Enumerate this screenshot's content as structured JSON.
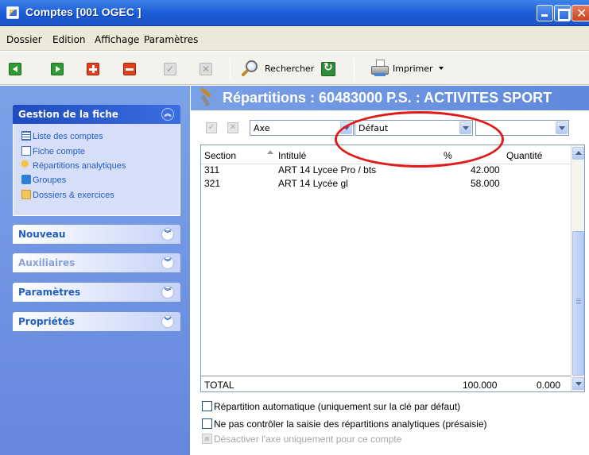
{
  "window": {
    "title": "Comptes [001 OGEC ]"
  },
  "menu": {
    "items": [
      "Dossier",
      "Edition",
      "Affichage",
      "Paramètres"
    ]
  },
  "toolbar": {
    "search_label": "Rechercher",
    "print_label": "Imprimer"
  },
  "sidebar": {
    "panels": [
      {
        "label": "Gestion de la fiche",
        "expanded": true,
        "items": [
          {
            "label": "Liste des comptes",
            "icon": "list-icon"
          },
          {
            "label": "Fiche compte",
            "icon": "card-icon"
          },
          {
            "label": "Répartitions analytiques",
            "icon": "key-icon"
          },
          {
            "label": "Groupes",
            "icon": "group-icon"
          },
          {
            "label": "Dossiers & exercices",
            "icon": "folder-icon"
          }
        ]
      },
      {
        "label": "Nouveau",
        "expanded": false
      },
      {
        "label": "Auxiliaires",
        "expanded": false
      },
      {
        "label": "Paramètres",
        "expanded": false
      },
      {
        "label": "Propriétés",
        "expanded": false
      }
    ]
  },
  "main": {
    "title": "Répartitions : 60483000 P.S. : ACTIVITES SPORT",
    "filters": {
      "axe": "Axe",
      "cle": "Défaut",
      "third": ""
    },
    "grid": {
      "columns": [
        "Section",
        "Intitulé",
        "%",
        "Quantité"
      ],
      "rows": [
        {
          "section": "311",
          "intitule": "ART 14 Lycee Pro / bts",
          "pct": "42.000",
          "qty": ""
        },
        {
          "section": "321",
          "intitule": "ART 14 Lycée gl",
          "pct": "58.000",
          "qty": ""
        }
      ],
      "total": {
        "label": "TOTAL",
        "pct": "100.000",
        "qty": "0.000"
      }
    },
    "options": [
      {
        "label": "Répartition automatique (uniquement sur la clé par défaut)",
        "checked": false,
        "enabled": true
      },
      {
        "label": "Ne pas contrôler la saisie des répartitions analytiques (présaisie)",
        "checked": false,
        "enabled": true
      },
      {
        "label": "Désactiver l'axe uniquement pour ce compte",
        "checked": false,
        "enabled": false
      }
    ]
  },
  "colors": {
    "titlebar": "#1a5bd6",
    "sidebar": "#6f93e0",
    "annotation": "#e01919"
  }
}
